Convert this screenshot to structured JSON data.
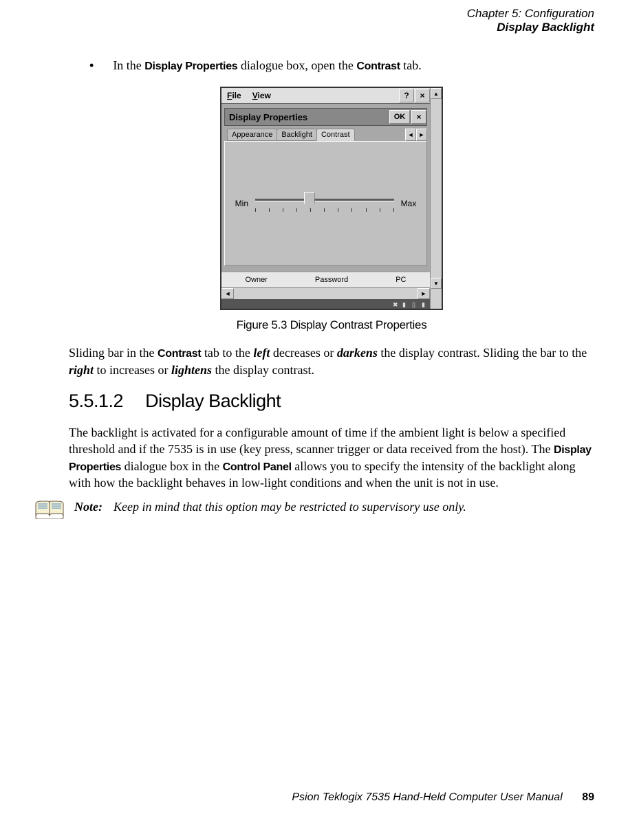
{
  "header": {
    "chapter": "Chapter 5: Configuration",
    "section": "Display Backlight"
  },
  "step": {
    "pre": "In the ",
    "dp": "Display Properties",
    "mid": " dialogue box, open the ",
    "contrast": "Contrast",
    "post": " tab."
  },
  "screenshot": {
    "menu_file": "File",
    "menu_view": "View",
    "help": "?",
    "close": "×",
    "dialog_title": "Display Properties",
    "ok": "OK",
    "tabs": {
      "appearance": "Appearance",
      "backlight": "Backlight",
      "contrast": "Contrast"
    },
    "arrow_left": "◄",
    "arrow_right": "►",
    "min": "Min",
    "max": "Max",
    "bottom": {
      "owner": "Owner",
      "password": "Password",
      "pc": "PC"
    },
    "up": "▲",
    "down": "▼"
  },
  "figure_caption": "Figure 5.3 Display Contrast Properties",
  "para1": {
    "t1": "Sliding bar in the ",
    "contrast": "Contrast",
    "t2": " tab to the ",
    "left": "left",
    "t3": " decreases or ",
    "darkens": "darkens",
    "t4": " the display contrast. Sliding the bar to the ",
    "right": "right",
    "t5": " to increases or ",
    "lightens": "lightens",
    "t6": " the display contrast."
  },
  "heading": {
    "num": "5.5.1.2",
    "title": "Display Backlight"
  },
  "para2": {
    "t1": "The backlight is activated for a configurable amount of time if the ambient light is below a specified threshold and if the 7535 is in use (key press, scanner trigger or data received from the host). The ",
    "dp": "Display Properties",
    "t2": " dialogue box in the ",
    "cp": "Control Panel",
    "t3": " allows you to specify the intensity of the backlight along with how the backlight behaves in low-light conditions and when the unit is not in use."
  },
  "note": {
    "label": "Note:",
    "text": "Keep in mind that this option may be restricted to supervisory use only."
  },
  "footer": {
    "manual": "Psion Teklogix 7535 Hand-Held Computer User Manual",
    "page": "89"
  }
}
